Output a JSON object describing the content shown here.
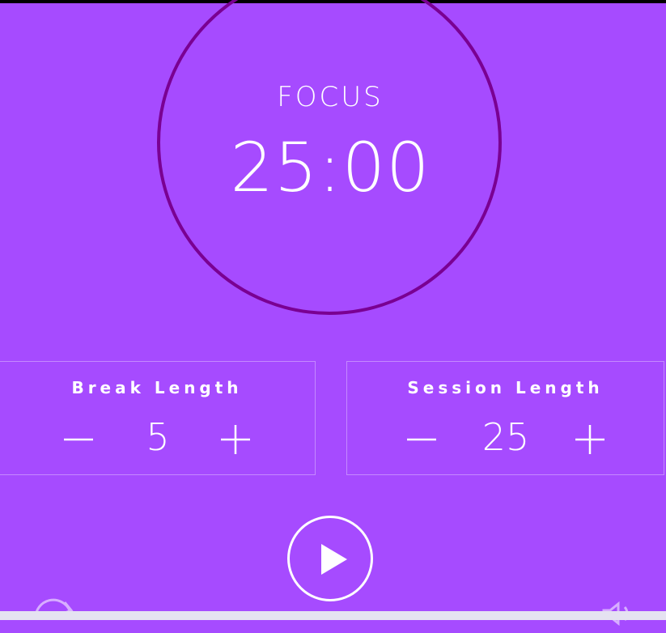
{
  "timer": {
    "label": "FOCUS",
    "time": "25:00"
  },
  "break_length": {
    "title": "Break Length",
    "value": "5",
    "decrement_icon": "minus-icon",
    "increment_icon": "plus-icon"
  },
  "session_length": {
    "title": "Session Length",
    "value": "25",
    "decrement_icon": "minus-icon",
    "increment_icon": "plus-icon"
  },
  "controls": {
    "play_icon": "play-icon",
    "reset_icon": "reset-icon",
    "sound_icon": "sound-icon"
  },
  "colors": {
    "background": "#a64bff",
    "ring": "#7a0092",
    "text": "#ffffff",
    "bottom_strip": "#e5e2f1"
  }
}
